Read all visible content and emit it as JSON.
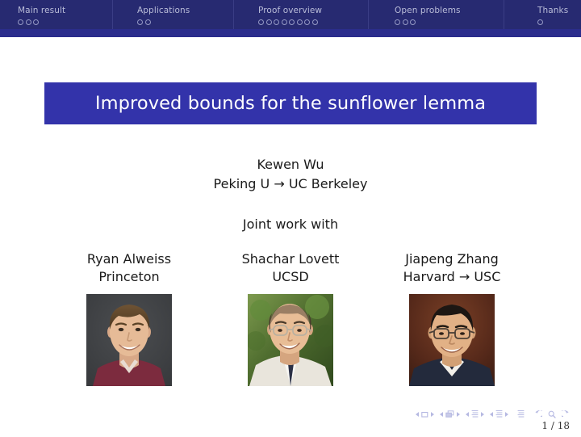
{
  "nav": {
    "sections": [
      {
        "label": "Main result",
        "slide_count": 3,
        "current": false
      },
      {
        "label": "Applications",
        "slide_count": 2,
        "current": false
      },
      {
        "label": "Proof overview",
        "slide_count": 8,
        "current": false
      },
      {
        "label": "Open problems",
        "slide_count": 3,
        "current": false
      },
      {
        "label": "Thanks",
        "slide_count": 1,
        "current": false
      }
    ],
    "bar_color": "#272a71",
    "subbar_color": "#2b2d8c",
    "text_color": "#b9bcd8"
  },
  "title": {
    "text": "Improved bounds for the sunflower lemma",
    "box_color": "#3333aa",
    "text_color": "#ffffff"
  },
  "author": {
    "name": "Kewen Wu",
    "affiliation": "Peking U → UC Berkeley"
  },
  "joint": {
    "label": "Joint work with"
  },
  "collaborators": [
    {
      "name": "Ryan Alweiss",
      "affiliation": "Princeton",
      "photo_alt": "portrait-ryan-alweiss"
    },
    {
      "name": "Shachar Lovett",
      "affiliation": "UCSD",
      "photo_alt": "portrait-shachar-lovett"
    },
    {
      "name": "Jiapeng Zhang",
      "affiliation": "Harvard → USC",
      "photo_alt": "portrait-jiapeng-zhang"
    }
  ],
  "footer": {
    "page_label": "1 / 18",
    "nav_symbols": [
      "previous-slide-icon",
      "slide-icon",
      "next-slide-icon",
      "previous-frame-icon",
      "frame-icon",
      "next-frame-icon",
      "previous-subsection-icon",
      "subsection-icon",
      "next-subsection-icon",
      "previous-section-icon",
      "section-icon",
      "next-section-icon",
      "presentation-icon",
      "back-icon",
      "find-icon",
      "forward-icon"
    ],
    "symbol_color": "#b6b9e2"
  }
}
